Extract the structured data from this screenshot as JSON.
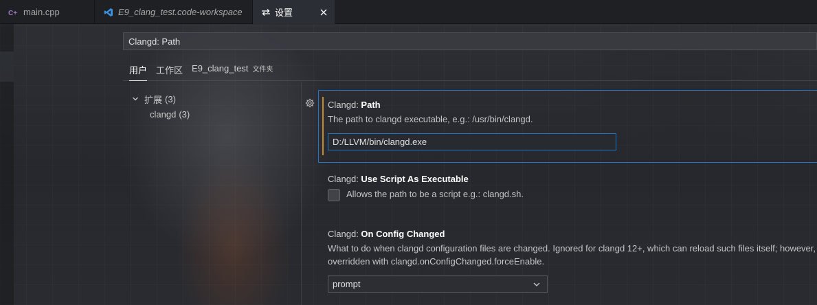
{
  "tabs": [
    {
      "label": "main.cpp",
      "icon": "cpp-file-icon",
      "italic": false,
      "active": false
    },
    {
      "label": "E9_clang_test.code-workspace",
      "icon": "vscode-icon",
      "italic": true,
      "active": false
    },
    {
      "label": "设置",
      "icon": "settings-icon",
      "italic": false,
      "active": true
    }
  ],
  "search": {
    "value": "Clangd: Path"
  },
  "scope_tabs": [
    {
      "label": "用户",
      "active": true
    },
    {
      "label": "工作区",
      "active": false
    },
    {
      "label": "E9_clang_test",
      "sub": "文件夹",
      "active": false
    }
  ],
  "toc": {
    "group_label": "扩展",
    "group_count": "(3)",
    "child_label": "clangd",
    "child_count": "(3)"
  },
  "settings": {
    "path": {
      "category": "Clangd: ",
      "name": "Path",
      "description": "The path to clangd executable, e.g.: /usr/bin/clangd.",
      "value": "D:/LLVM/bin/clangd.exe"
    },
    "use_script": {
      "category": "Clangd: ",
      "name": "Use Script As Executable",
      "description": "Allows the path to be a script e.g.: clangd.sh.",
      "checked": false
    },
    "on_config_changed": {
      "category": "Clangd: ",
      "name": "On Config Changed",
      "description_line1": "What to do when clangd configuration files are changed. Ignored for clangd 12+, which can reload such files itself; however,",
      "description_line2": "overridden with clangd.onConfigChanged.forceEnable.",
      "value": "prompt"
    }
  },
  "colors": {
    "focus_border": "#1f77c6",
    "modified_indicator": "#c58a2c",
    "cpp_icon": "#a074c4",
    "vscode_icon": "#3b8ee0"
  }
}
